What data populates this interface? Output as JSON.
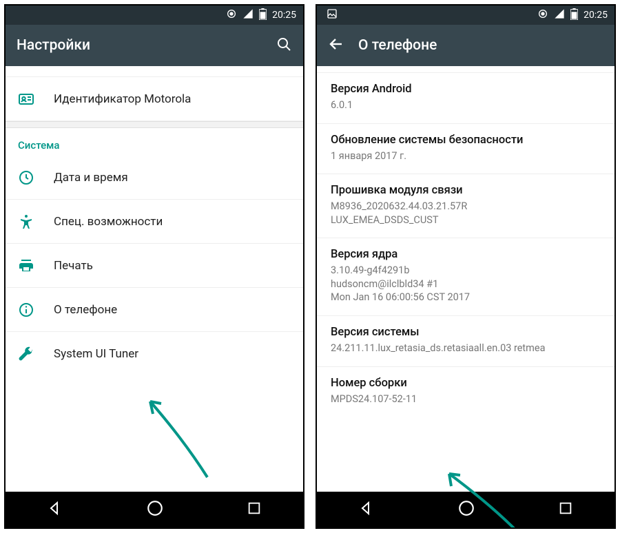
{
  "status": {
    "time": "20:25"
  },
  "left": {
    "title": "Настройки",
    "top_item": "Идентификатор Motorola",
    "section": "Система",
    "items": {
      "datetime": "Дата и время",
      "accessibility": "Спец. возможности",
      "print": "Печать",
      "about": "О телефоне",
      "tuner": "System UI Tuner"
    }
  },
  "right": {
    "title": "О телефоне",
    "blocks": {
      "android": {
        "title": "Версия Android",
        "sub": "6.0.1"
      },
      "security": {
        "title": "Обновление системы безопасности",
        "sub": "1 января 2017 г."
      },
      "baseband": {
        "title": "Прошивка модуля связи",
        "sub": "M8936_2020632.44.03.21.57R\nLUX_EMEA_DSDS_CUST"
      },
      "kernel": {
        "title": "Версия ядра",
        "sub": "3.10.49-g4f4291b\nhudsoncm@ilclbld34 #1\nMon Jan 16 06:00:56 CST 2017"
      },
      "system": {
        "title": "Версия системы",
        "sub": "24.211.11.lux_retasia_ds.retasiaall.en.03 retmea"
      },
      "build": {
        "title": "Номер сборки",
        "sub": "MPDS24.107-52-11"
      }
    }
  },
  "accent": "#009688"
}
